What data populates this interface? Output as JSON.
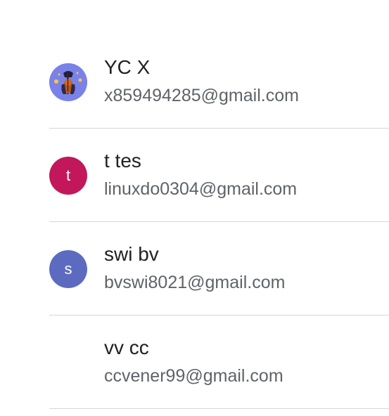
{
  "accounts": [
    {
      "name": "YC X",
      "email": "x859494285@gmail.com",
      "avatar": {
        "type": "image",
        "icon": "cello-player-avatar",
        "bg_color": "#7a82e8"
      }
    },
    {
      "name": "t tes",
      "email": "linuxdo0304@gmail.com",
      "avatar": {
        "type": "letter",
        "letter": "t",
        "bg_color": "#c2185b"
      }
    },
    {
      "name": "swi bv",
      "email": "bvswi8021@gmail.com",
      "avatar": {
        "type": "letter",
        "letter": "s",
        "bg_color": "#5c6bc0"
      }
    },
    {
      "name": "vv cc",
      "email": "ccvener99@gmail.com",
      "avatar": {
        "type": "none"
      }
    }
  ]
}
